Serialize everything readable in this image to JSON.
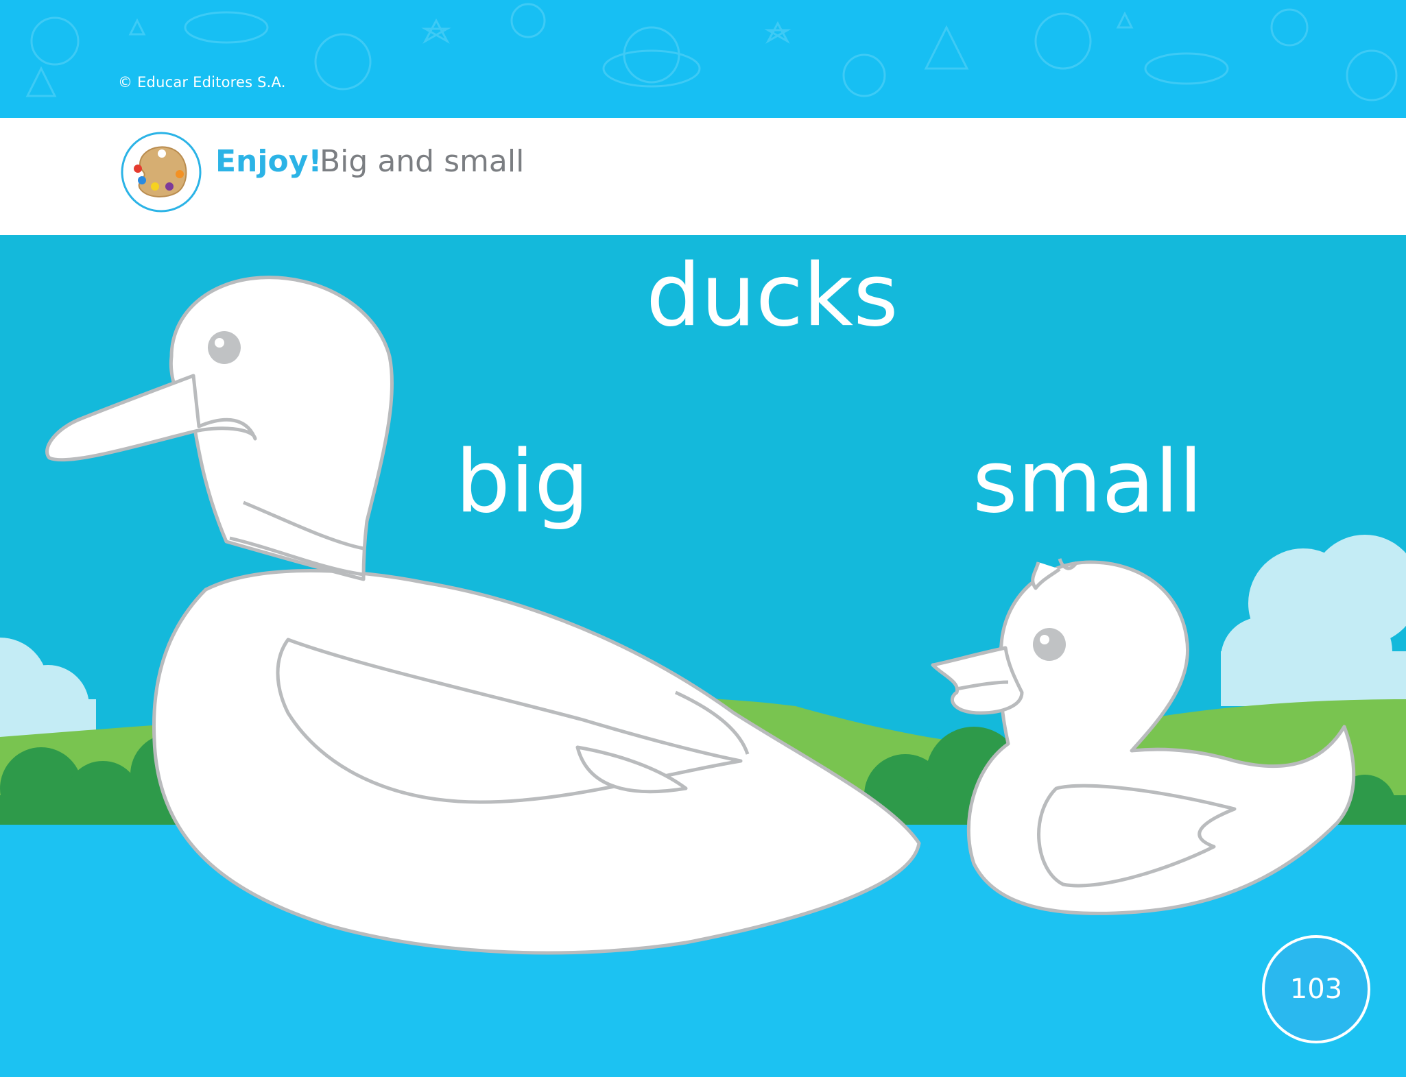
{
  "header": {
    "copyright": "© Educar Editores S.A."
  },
  "title_bar": {
    "section_label": "Enjoy!",
    "activity_title": "Big and small",
    "icon": "palette-icon"
  },
  "scene": {
    "heading_word": "ducks",
    "left_label": "big",
    "right_label": "small",
    "left_figure": "big-duck-outline",
    "right_figure": "small-duckling-outline"
  },
  "footer": {
    "page_number": "103"
  },
  "colors": {
    "top_band": "#17bff3",
    "sky": "#14b9db",
    "water": "#1cc2f2",
    "grass": "#79c450",
    "bushes": "#2e9a4a",
    "outline": "#b9bbbd",
    "accent_text": "#2bb3e6",
    "title_text": "#7b7e82"
  }
}
